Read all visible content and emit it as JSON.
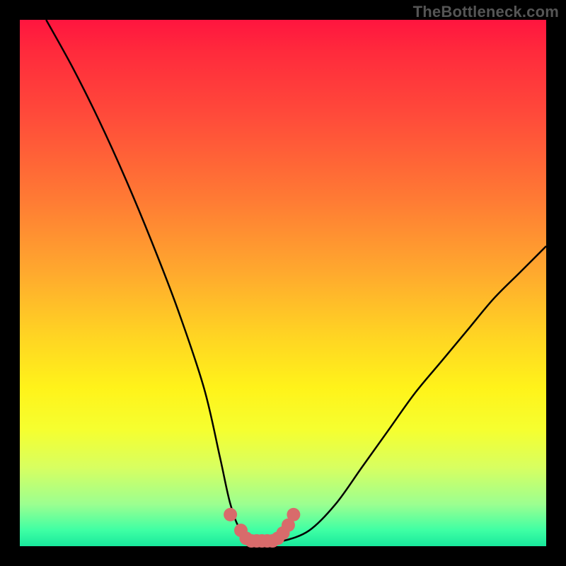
{
  "watermark": "TheBottleneck.com",
  "chart_data": {
    "type": "line",
    "title": "",
    "xlabel": "",
    "ylabel": "",
    "xlim": [
      0,
      100
    ],
    "ylim": [
      0,
      100
    ],
    "grid": false,
    "legend": false,
    "series": [
      {
        "name": "bottleneck-curve",
        "color": "#000000",
        "x": [
          5,
          10,
          15,
          20,
          25,
          30,
          35,
          38,
          40,
          42,
          45,
          47,
          50,
          55,
          60,
          65,
          70,
          75,
          80,
          85,
          90,
          95,
          100
        ],
        "y": [
          100,
          91,
          81,
          70,
          58,
          45,
          30,
          17,
          8,
          3,
          1,
          1,
          1,
          3,
          8,
          15,
          22,
          29,
          35,
          41,
          47,
          52,
          57
        ]
      },
      {
        "name": "marker-band",
        "type": "scatter",
        "color": "#d86b6b",
        "x": [
          40,
          42,
          43,
          44,
          45,
          46,
          47,
          48,
          49,
          50,
          51,
          52
        ],
        "y": [
          6,
          3,
          1.5,
          1,
          1,
          1,
          1,
          1,
          1.5,
          2.5,
          4,
          6
        ]
      }
    ],
    "annotations": []
  },
  "colors": {
    "frame": "#000000",
    "gradient_top": "#ff153f",
    "gradient_bottom": "#18e99c",
    "curve": "#000000",
    "markers": "#d86b6b",
    "watermark": "#555555"
  }
}
